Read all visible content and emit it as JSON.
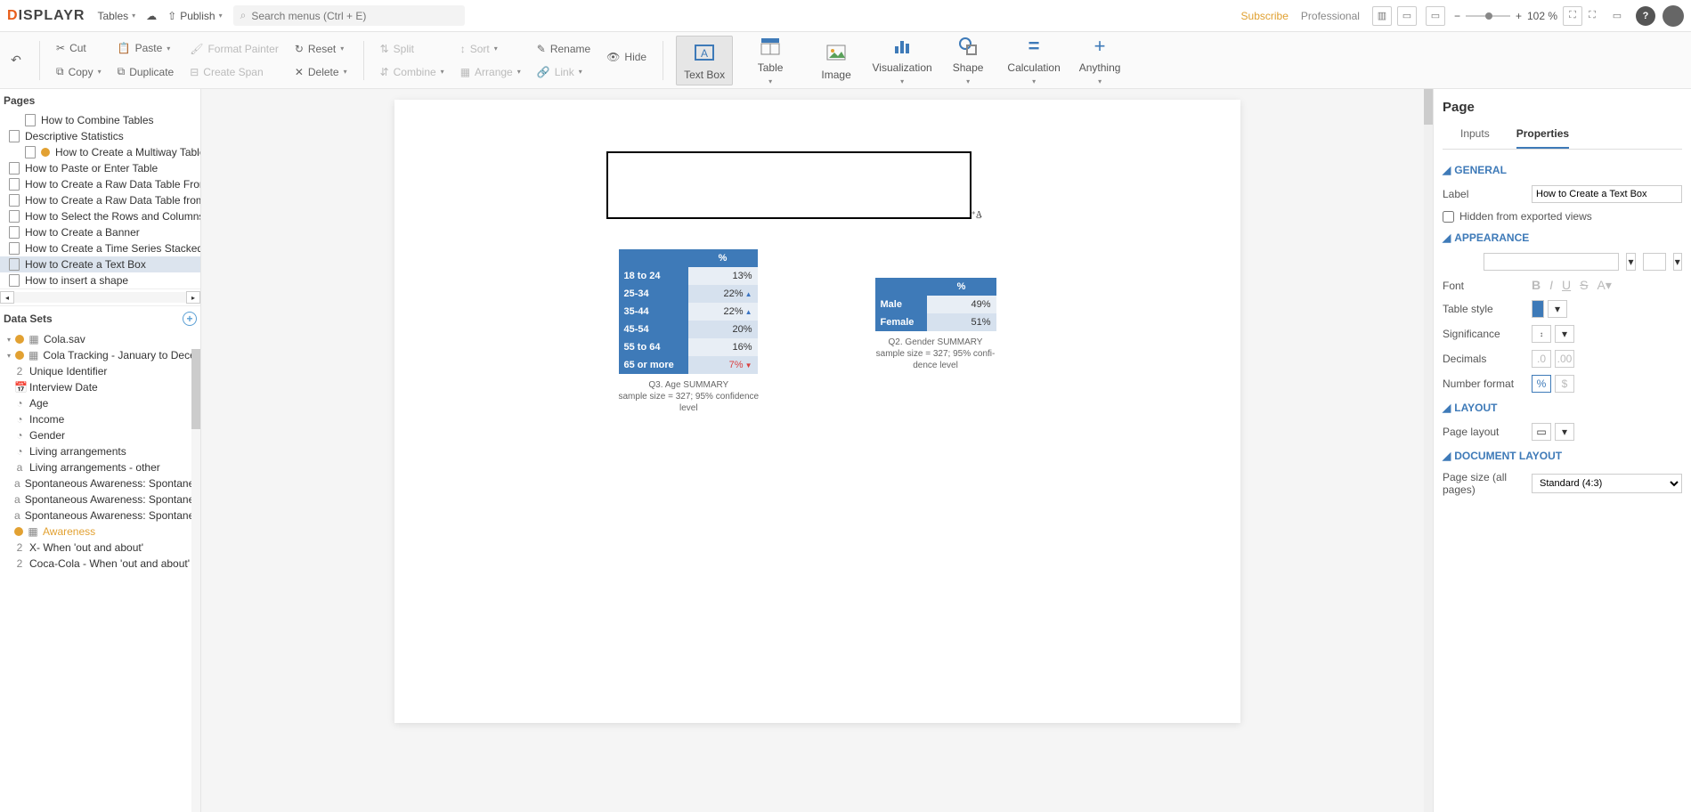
{
  "header": {
    "logo": "DISPLAYR",
    "tables_menu": "Tables",
    "publish": "Publish",
    "search_placeholder": "Search menus (Ctrl + E)",
    "subscribe": "Subscribe",
    "professional": "Professional",
    "zoom_pct": "102 %"
  },
  "ribbon": {
    "cut": "Cut",
    "copy": "Copy",
    "paste": "Paste",
    "duplicate": "Duplicate",
    "format_painter": "Format Painter",
    "create_span": "Create Span",
    "reset": "Reset",
    "delete": "Delete",
    "split": "Split",
    "combine": "Combine",
    "sort": "Sort",
    "arrange": "Arrange",
    "rename": "Rename",
    "link": "Link",
    "hide": "Hide",
    "text_box": "Text Box",
    "table": "Table",
    "image": "Image",
    "visualization": "Visualization",
    "shape": "Shape",
    "calculation": "Calculation",
    "anything": "Anything"
  },
  "pages": {
    "title": "Pages",
    "items": [
      {
        "label": "How to Combine Tables",
        "warn": false,
        "indent": true
      },
      {
        "label": "Descriptive Statistics",
        "warn": false,
        "indent": false
      },
      {
        "label": "How to Create a Multiway Table",
        "warn": true,
        "indent": true
      },
      {
        "label": "How to Paste or Enter Table",
        "warn": false,
        "indent": false
      },
      {
        "label": "How to Create a Raw Data Table From a V",
        "warn": false,
        "indent": false
      },
      {
        "label": "How to Create a Raw Data Table from Var",
        "warn": false,
        "indent": false
      },
      {
        "label": "How to Select the Rows and Columns to A",
        "warn": false,
        "indent": false
      },
      {
        "label": "How to Create a Banner",
        "warn": false,
        "indent": false
      },
      {
        "label": "How to Create a Time Series Stacked by Y",
        "warn": false,
        "indent": false
      },
      {
        "label": "How to Create a Text Box",
        "warn": false,
        "indent": false,
        "selected": true
      },
      {
        "label": "How to insert a shape",
        "warn": false,
        "indent": false
      }
    ]
  },
  "datasets": {
    "title": "Data Sets",
    "items": [
      {
        "label": "Cola.sav",
        "type": "file",
        "root": true,
        "warn": true
      },
      {
        "label": "Cola Tracking - January to December.",
        "type": "file",
        "root": true,
        "warn": true
      },
      {
        "label": "Unique Identifier",
        "type": "num"
      },
      {
        "label": "Interview Date",
        "type": "date"
      },
      {
        "label": "Age",
        "type": "var"
      },
      {
        "label": "Income",
        "type": "var"
      },
      {
        "label": "Gender",
        "type": "var"
      },
      {
        "label": "Living arrangements",
        "type": "var"
      },
      {
        "label": "Living arrangements - other",
        "type": "text"
      },
      {
        "label": "Spontaneous Awareness: Spontaneou",
        "type": "text"
      },
      {
        "label": "Spontaneous Awareness: Spontaneou",
        "type": "text"
      },
      {
        "label": "Spontaneous Awareness: Spontaneou",
        "type": "text"
      },
      {
        "label": "Awareness",
        "type": "grid",
        "hl": true,
        "warn": true
      },
      {
        "label": "X- When 'out and about'",
        "type": "num"
      },
      {
        "label": "Coca-Cola - When 'out and about'",
        "type": "num"
      }
    ]
  },
  "canvas": {
    "table1": {
      "header_pct": "%",
      "rows": [
        {
          "label": "18 to 24",
          "value": "13%",
          "arrow": ""
        },
        {
          "label": "25-34",
          "value": "22%",
          "arrow": "up"
        },
        {
          "label": "35-44",
          "value": "22%",
          "arrow": "up"
        },
        {
          "label": "45-54",
          "value": "20%",
          "arrow": ""
        },
        {
          "label": "55 to 64",
          "value": "16%",
          "arrow": ""
        },
        {
          "label": "65 or more",
          "value": "7%",
          "arrow": "down",
          "red": true
        }
      ],
      "caption1": "Q3. Age SUMMARY",
      "caption2": "sample size = 327; 95% confidence",
      "caption3": "level"
    },
    "table2": {
      "header_pct": "%",
      "rows": [
        {
          "label": "Male",
          "value": "49%"
        },
        {
          "label": "Female",
          "value": "51%"
        }
      ],
      "caption1": "Q2. Gender SUMMARY",
      "caption2": "sample size = 327; 95% confi-",
      "caption3": "dence level"
    }
  },
  "right": {
    "title": "Page",
    "tab_inputs": "Inputs",
    "tab_properties": "Properties",
    "general": "GENERAL",
    "label": "Label",
    "label_value": "How to Create a Text Box",
    "hidden": "Hidden from exported views",
    "appearance": "APPEARANCE",
    "font": "Font",
    "table_style": "Table style",
    "significance": "Significance",
    "decimals": "Decimals",
    "number_format": "Number format",
    "layout": "LAYOUT",
    "page_layout": "Page layout",
    "document_layout": "DOCUMENT LAYOUT",
    "page_size": "Page size (all pages)",
    "page_size_value": "Standard (4:3)"
  },
  "chart_data": [
    {
      "type": "table",
      "title": "Q3. Age SUMMARY",
      "note": "sample size = 327; 95% confidence level",
      "columns": [
        "%"
      ],
      "rows": [
        {
          "category": "18 to 24",
          "pct": 13
        },
        {
          "category": "25-34",
          "pct": 22,
          "sig": "up"
        },
        {
          "category": "35-44",
          "pct": 22,
          "sig": "up"
        },
        {
          "category": "45-54",
          "pct": 20
        },
        {
          "category": "55 to 64",
          "pct": 16
        },
        {
          "category": "65 or more",
          "pct": 7,
          "sig": "down"
        }
      ]
    },
    {
      "type": "table",
      "title": "Q2. Gender SUMMARY",
      "note": "sample size = 327; 95% confidence level",
      "columns": [
        "%"
      ],
      "rows": [
        {
          "category": "Male",
          "pct": 49
        },
        {
          "category": "Female",
          "pct": 51
        }
      ]
    }
  ]
}
